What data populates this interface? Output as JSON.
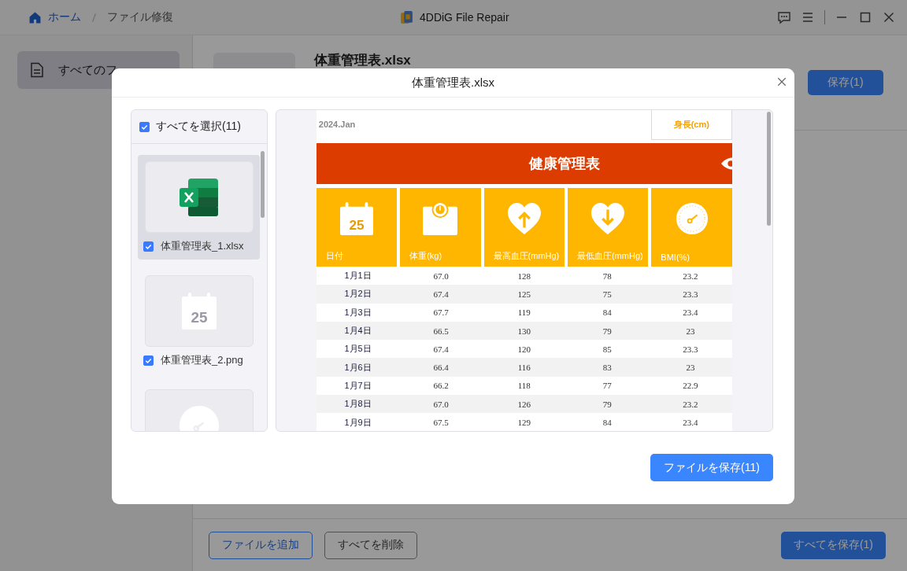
{
  "window": {
    "breadcrumb": [
      {
        "label": "ホーム",
        "kind": "home"
      },
      {
        "label": "ファイル修復",
        "kind": "current"
      }
    ],
    "title": "4DDiG File Repair"
  },
  "sidebar": {
    "items": [
      {
        "label": "すべてのフ",
        "selected": true
      }
    ]
  },
  "file": {
    "name": "体重管理表.xlsx",
    "save_button": "保存(1)"
  },
  "footer": {
    "buttons": [
      {
        "label": "ファイルを追加",
        "kind": "outline"
      },
      {
        "label": "すべてを削除",
        "kind": "plain"
      },
      {
        "label": "すべてを保存(1)",
        "kind": "primary"
      }
    ]
  },
  "dialog": {
    "title": "体重管理表.xlsx",
    "select_all": {
      "label": "すべてを選択(11)",
      "checked": true
    },
    "files": [
      {
        "name": "体重管理表_1.xlsx",
        "checked": true,
        "selected": true,
        "kind": "spreadsheet"
      },
      {
        "name": "体重管理表_2.png",
        "checked": true,
        "selected": false,
        "kind": "image",
        "day": "25"
      },
      {
        "selected": false,
        "kind": "chart"
      }
    ],
    "preview": {
      "period": "2024.Jan",
      "height_label": "身長(cm)",
      "title": "健康管理表",
      "columns": [
        {
          "label": "日付",
          "day": "25"
        },
        {
          "label": "体重(kg)"
        },
        {
          "label": "最高血圧(mmHg)"
        },
        {
          "label": "最低血圧(mmHg)"
        },
        {
          "label": "BMI(%)"
        }
      ],
      "rows": [
        [
          "1月1日",
          "67.0",
          "128",
          "78",
          "23.2"
        ],
        [
          "1月2日",
          "67.4",
          "125",
          "75",
          "23.3"
        ],
        [
          "1月3日",
          "67.7",
          "119",
          "84",
          "23.4"
        ],
        [
          "1月4日",
          "66.5",
          "130",
          "79",
          "23"
        ],
        [
          "1月5日",
          "67.4",
          "120",
          "85",
          "23.3"
        ],
        [
          "1月6日",
          "66.4",
          "116",
          "83",
          "23"
        ],
        [
          "1月7日",
          "66.2",
          "118",
          "77",
          "22.9"
        ],
        [
          "1月8日",
          "67.0",
          "126",
          "79",
          "23.2"
        ],
        [
          "1月9日",
          "67.5",
          "129",
          "84",
          "23.4"
        ]
      ]
    },
    "save_button": "ファイルを保存(11)"
  }
}
